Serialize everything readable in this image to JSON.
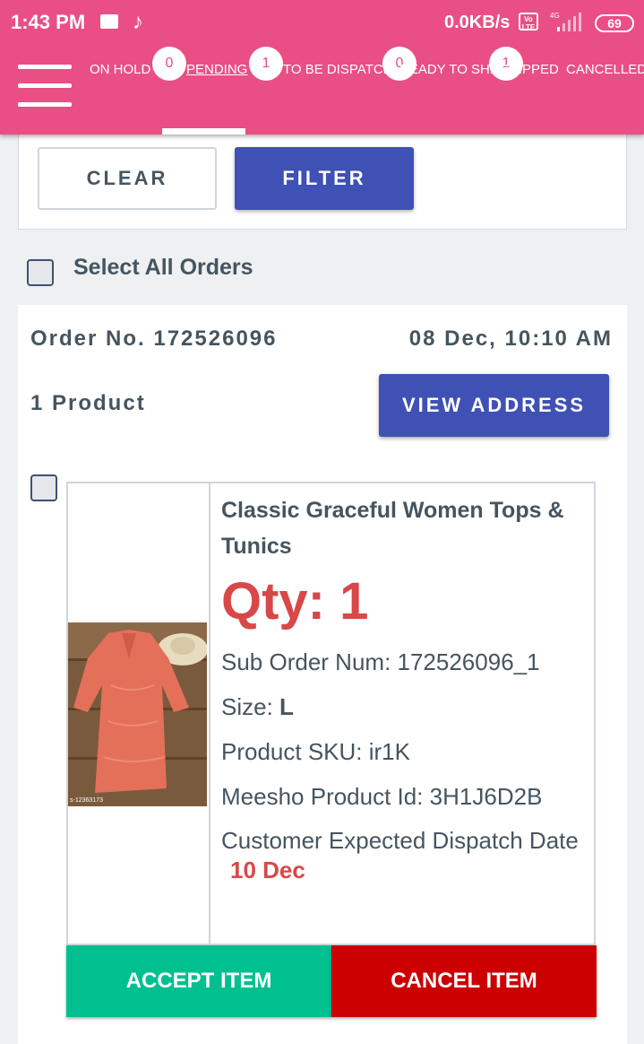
{
  "status_bar": {
    "time": "1:43 PM",
    "net_speed": "0.0KB/s",
    "volte": "Vo LTE",
    "network": "4G",
    "battery": "69"
  },
  "tabs": [
    {
      "label": "ON HOLD",
      "count": "0"
    },
    {
      "label": "PENDING",
      "count": "1",
      "active": true
    },
    {
      "label": "TO BE DISPATCHED",
      "count": "0"
    },
    {
      "label": "READY TO SHIP",
      "count": "1"
    },
    {
      "label": "SHIPPED"
    },
    {
      "label": "CANCELLED"
    }
  ],
  "filter": {
    "clear_label": "CLEAR",
    "filter_label": "FILTER"
  },
  "select_all_label": "Select All Orders",
  "order": {
    "number_text": "Order No. 172526096",
    "date_text": "08 Dec, 10:10 AM",
    "product_count_text": "1 Product",
    "view_address_label": "VIEW ADDRESS",
    "item": {
      "title": "Classic Graceful Women Tops & Tunics",
      "qty_text": "Qty: 1",
      "sub_order_text": "Sub Order Num: 172526096_1",
      "size_label": "Size: ",
      "size_value": "L",
      "sku_text": "Product SKU: ir1K",
      "meesho_id_text": "Meesho Product Id: 3H1J6D2B",
      "dispatch_label": "Customer Expected Dispatch Date",
      "dispatch_date": "10 Dec",
      "image_caption": "s-12363173",
      "accept_label": "ACCEPT ITEM",
      "cancel_label": "CANCEL ITEM"
    }
  },
  "colors": {
    "header": "#e94f84",
    "primary": "#3f51b5",
    "accept": "#00c08f",
    "cancel": "#cc0000",
    "qty": "#d84848"
  }
}
